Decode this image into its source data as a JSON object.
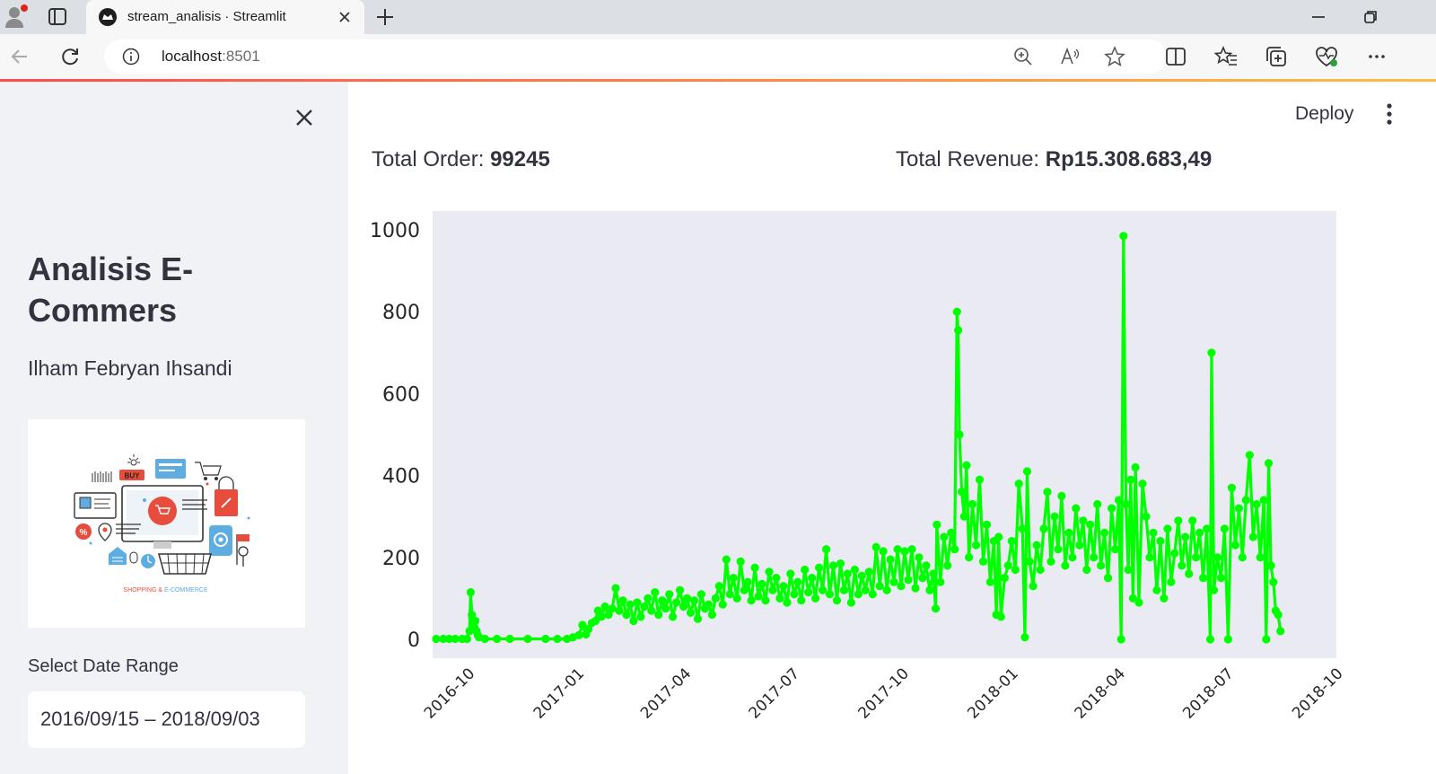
{
  "browser": {
    "tab_title": "stream_analisis · Streamlit",
    "url_host": "localhost",
    "url_port": ":8501"
  },
  "sidebar": {
    "title": "Analisis E-Commers",
    "author": "Ilham Febryan Ihsandi",
    "logo_caption_part1": "SHOPPING &",
    "logo_caption_part2": "E-COMMERCE",
    "logo_badge": "BUY",
    "date_label": "Select Date Range",
    "date_value": "2016/09/15 – 2018/09/03"
  },
  "header": {
    "deploy_label": "Deploy"
  },
  "metrics": {
    "orders_label": "Total Order:",
    "orders_value": "99245",
    "revenue_label": "Total Revenue:",
    "revenue_value": "Rp15.308.683,49"
  },
  "colors": {
    "line": "#00ff00",
    "plot_background": "#eaeaf2",
    "sidebar_background": "#f0f2f6",
    "accent": "#ff4b4b"
  },
  "chart_data": {
    "type": "line",
    "title": "",
    "xlabel": "",
    "ylabel": "",
    "ylim": [
      0,
      1000
    ],
    "yticks": [
      0,
      200,
      400,
      600,
      800,
      1000
    ],
    "xlim": [
      "2016-09-01",
      "2018-10-01"
    ],
    "xticks": [
      "2016-10",
      "2017-01",
      "2017-04",
      "2017-07",
      "2017-10",
      "2018-01",
      "2018-04",
      "2018-07",
      "2018-10"
    ],
    "series": [
      {
        "values": [
          [
            "2016-09-04",
            1
          ],
          [
            "2016-09-10",
            1
          ],
          [
            "2016-09-15",
            1
          ],
          [
            "2016-09-20",
            1
          ],
          [
            "2016-09-26",
            1
          ],
          [
            "2016-09-30",
            1
          ],
          [
            "2016-10-02",
            20
          ],
          [
            "2016-10-03",
            115
          ],
          [
            "2016-10-04",
            60
          ],
          [
            "2016-10-05",
            45
          ],
          [
            "2016-10-06",
            30
          ],
          [
            "2016-10-07",
            45
          ],
          [
            "2016-10-08",
            20
          ],
          [
            "2016-10-09",
            10
          ],
          [
            "2016-10-10",
            5
          ],
          [
            "2016-10-15",
            1
          ],
          [
            "2016-10-25",
            1
          ],
          [
            "2016-11-05",
            1
          ],
          [
            "2016-11-20",
            1
          ],
          [
            "2016-12-05",
            1
          ],
          [
            "2016-12-15",
            1
          ],
          [
            "2016-12-23",
            1
          ],
          [
            "2016-12-28",
            5
          ],
          [
            "2017-01-02",
            10
          ],
          [
            "2017-01-05",
            35
          ],
          [
            "2017-01-08",
            12
          ],
          [
            "2017-01-10",
            25
          ],
          [
            "2017-01-13",
            40
          ],
          [
            "2017-01-16",
            45
          ],
          [
            "2017-01-18",
            70
          ],
          [
            "2017-01-21",
            55
          ],
          [
            "2017-01-24",
            80
          ],
          [
            "2017-01-27",
            60
          ],
          [
            "2017-01-30",
            75
          ],
          [
            "2017-02-02",
            125
          ],
          [
            "2017-02-05",
            70
          ],
          [
            "2017-02-08",
            95
          ],
          [
            "2017-02-11",
            60
          ],
          [
            "2017-02-14",
            85
          ],
          [
            "2017-02-17",
            45
          ],
          [
            "2017-02-20",
            90
          ],
          [
            "2017-02-23",
            55
          ],
          [
            "2017-02-26",
            80
          ],
          [
            "2017-03-01",
            100
          ],
          [
            "2017-03-04",
            70
          ],
          [
            "2017-03-07",
            115
          ],
          [
            "2017-03-10",
            60
          ],
          [
            "2017-03-13",
            95
          ],
          [
            "2017-03-16",
            75
          ],
          [
            "2017-03-19",
            110
          ],
          [
            "2017-03-22",
            55
          ],
          [
            "2017-03-25",
            90
          ],
          [
            "2017-03-28",
            120
          ],
          [
            "2017-03-31",
            80
          ],
          [
            "2017-04-03",
            100
          ],
          [
            "2017-04-06",
            65
          ],
          [
            "2017-04-09",
            95
          ],
          [
            "2017-04-12",
            50
          ],
          [
            "2017-04-15",
            110
          ],
          [
            "2017-04-18",
            75
          ],
          [
            "2017-04-21",
            85
          ],
          [
            "2017-04-24",
            60
          ],
          [
            "2017-04-27",
            100
          ],
          [
            "2017-04-30",
            130
          ],
          [
            "2017-05-03",
            85
          ],
          [
            "2017-05-06",
            195
          ],
          [
            "2017-05-09",
            110
          ],
          [
            "2017-05-12",
            150
          ],
          [
            "2017-05-15",
            100
          ],
          [
            "2017-05-18",
            190
          ],
          [
            "2017-05-21",
            120
          ],
          [
            "2017-05-24",
            140
          ],
          [
            "2017-05-27",
            95
          ],
          [
            "2017-05-30",
            175
          ],
          [
            "2017-06-02",
            105
          ],
          [
            "2017-06-05",
            135
          ],
          [
            "2017-06-08",
            95
          ],
          [
            "2017-06-11",
            165
          ],
          [
            "2017-06-14",
            120
          ],
          [
            "2017-06-17",
            150
          ],
          [
            "2017-06-20",
            100
          ],
          [
            "2017-06-23",
            130
          ],
          [
            "2017-06-26",
            90
          ],
          [
            "2017-06-29",
            160
          ],
          [
            "2017-07-02",
            110
          ],
          [
            "2017-07-05",
            140
          ],
          [
            "2017-07-08",
            95
          ],
          [
            "2017-07-11",
            170
          ],
          [
            "2017-07-14",
            115
          ],
          [
            "2017-07-17",
            150
          ],
          [
            "2017-07-20",
            100
          ],
          [
            "2017-07-23",
            175
          ],
          [
            "2017-07-26",
            120
          ],
          [
            "2017-07-29",
            220
          ],
          [
            "2017-08-01",
            110
          ],
          [
            "2017-08-04",
            180
          ],
          [
            "2017-08-07",
            95
          ],
          [
            "2017-08-10",
            185
          ],
          [
            "2017-08-13",
            120
          ],
          [
            "2017-08-16",
            160
          ],
          [
            "2017-08-19",
            90
          ],
          [
            "2017-08-22",
            170
          ],
          [
            "2017-08-25",
            110
          ],
          [
            "2017-08-28",
            155
          ],
          [
            "2017-08-31",
            120
          ],
          [
            "2017-09-03",
            165
          ],
          [
            "2017-09-06",
            110
          ],
          [
            "2017-09-09",
            225
          ],
          [
            "2017-09-12",
            130
          ],
          [
            "2017-09-15",
            215
          ],
          [
            "2017-09-18",
            120
          ],
          [
            "2017-09-21",
            195
          ],
          [
            "2017-09-24",
            140
          ],
          [
            "2017-09-27",
            220
          ],
          [
            "2017-09-30",
            130
          ],
          [
            "2017-10-03",
            215
          ],
          [
            "2017-10-06",
            145
          ],
          [
            "2017-10-09",
            220
          ],
          [
            "2017-10-12",
            125
          ],
          [
            "2017-10-15",
            200
          ],
          [
            "2017-10-18",
            150
          ],
          [
            "2017-10-21",
            180
          ],
          [
            "2017-10-24",
            120
          ],
          [
            "2017-10-27",
            160
          ],
          [
            "2017-10-29",
            75
          ],
          [
            "2017-10-30",
            280
          ],
          [
            "2017-11-02",
            140
          ],
          [
            "2017-11-05",
            250
          ],
          [
            "2017-11-08",
            180
          ],
          [
            "2017-11-11",
            260
          ],
          [
            "2017-11-14",
            220
          ],
          [
            "2017-11-16",
            800
          ],
          [
            "2017-11-17",
            755
          ],
          [
            "2017-11-18",
            500
          ],
          [
            "2017-11-20",
            360
          ],
          [
            "2017-11-22",
            300
          ],
          [
            "2017-11-24",
            425
          ],
          [
            "2017-11-26",
            200
          ],
          [
            "2017-11-29",
            330
          ],
          [
            "2017-12-02",
            230
          ],
          [
            "2017-12-05",
            390
          ],
          [
            "2017-12-08",
            190
          ],
          [
            "2017-12-11",
            280
          ],
          [
            "2017-12-14",
            140
          ],
          [
            "2017-12-17",
            240
          ],
          [
            "2017-12-19",
            60
          ],
          [
            "2017-12-21",
            250
          ],
          [
            "2017-12-23",
            55
          ],
          [
            "2017-12-26",
            150
          ],
          [
            "2017-12-29",
            180
          ],
          [
            "2018-01-01",
            240
          ],
          [
            "2018-01-04",
            170
          ],
          [
            "2018-01-07",
            380
          ],
          [
            "2018-01-10",
            270
          ],
          [
            "2018-01-12",
            5
          ],
          [
            "2018-01-14",
            410
          ],
          [
            "2018-01-16",
            190
          ],
          [
            "2018-01-19",
            130
          ],
          [
            "2018-01-22",
            230
          ],
          [
            "2018-01-25",
            170
          ],
          [
            "2018-01-28",
            270
          ],
          [
            "2018-01-31",
            360
          ],
          [
            "2018-02-03",
            190
          ],
          [
            "2018-02-06",
            300
          ],
          [
            "2018-02-09",
            220
          ],
          [
            "2018-02-12",
            350
          ],
          [
            "2018-02-15",
            180
          ],
          [
            "2018-02-18",
            260
          ],
          [
            "2018-02-21",
            200
          ],
          [
            "2018-02-24",
            320
          ],
          [
            "2018-02-27",
            230
          ],
          [
            "2018-03-02",
            290
          ],
          [
            "2018-03-05",
            170
          ],
          [
            "2018-03-08",
            280
          ],
          [
            "2018-03-11",
            200
          ],
          [
            "2018-03-14",
            330
          ],
          [
            "2018-03-17",
            180
          ],
          [
            "2018-03-20",
            260
          ],
          [
            "2018-03-23",
            150
          ],
          [
            "2018-03-26",
            320
          ],
          [
            "2018-03-29",
            220
          ],
          [
            "2018-04-01",
            340
          ],
          [
            "2018-04-03",
            0
          ],
          [
            "2018-04-05",
            985
          ],
          [
            "2018-04-07",
            330
          ],
          [
            "2018-04-09",
            170
          ],
          [
            "2018-04-11",
            390
          ],
          [
            "2018-04-13",
            100
          ],
          [
            "2018-04-15",
            420
          ],
          [
            "2018-04-18",
            90
          ],
          [
            "2018-04-21",
            380
          ],
          [
            "2018-04-24",
            300
          ],
          [
            "2018-04-27",
            200
          ],
          [
            "2018-04-30",
            260
          ],
          [
            "2018-05-03",
            120
          ],
          [
            "2018-05-06",
            240
          ],
          [
            "2018-05-09",
            100
          ],
          [
            "2018-05-12",
            270
          ],
          [
            "2018-05-15",
            140
          ],
          [
            "2018-05-18",
            210
          ],
          [
            "2018-05-21",
            290
          ],
          [
            "2018-05-24",
            180
          ],
          [
            "2018-05-27",
            250
          ],
          [
            "2018-05-30",
            160
          ],
          [
            "2018-06-02",
            290
          ],
          [
            "2018-06-05",
            200
          ],
          [
            "2018-06-08",
            260
          ],
          [
            "2018-06-11",
            150
          ],
          [
            "2018-06-14",
            270
          ],
          [
            "2018-06-17",
            0
          ],
          [
            "2018-06-18",
            700
          ],
          [
            "2018-06-20",
            120
          ],
          [
            "2018-06-23",
            200
          ],
          [
            "2018-06-26",
            150
          ],
          [
            "2018-06-29",
            270
          ],
          [
            "2018-07-02",
            0
          ],
          [
            "2018-07-05",
            370
          ],
          [
            "2018-07-08",
            230
          ],
          [
            "2018-07-11",
            320
          ],
          [
            "2018-07-14",
            200
          ],
          [
            "2018-07-17",
            340
          ],
          [
            "2018-07-20",
            450
          ],
          [
            "2018-07-23",
            250
          ],
          [
            "2018-07-26",
            330
          ],
          [
            "2018-07-29",
            200
          ],
          [
            "2018-08-01",
            340
          ],
          [
            "2018-08-03",
            0
          ],
          [
            "2018-08-05",
            430
          ],
          [
            "2018-08-07",
            180
          ],
          [
            "2018-08-09",
            140
          ],
          [
            "2018-08-11",
            70
          ],
          [
            "2018-08-13",
            60
          ],
          [
            "2018-08-15",
            20
          ]
        ]
      }
    ],
    "grid": false,
    "legend": "none"
  }
}
